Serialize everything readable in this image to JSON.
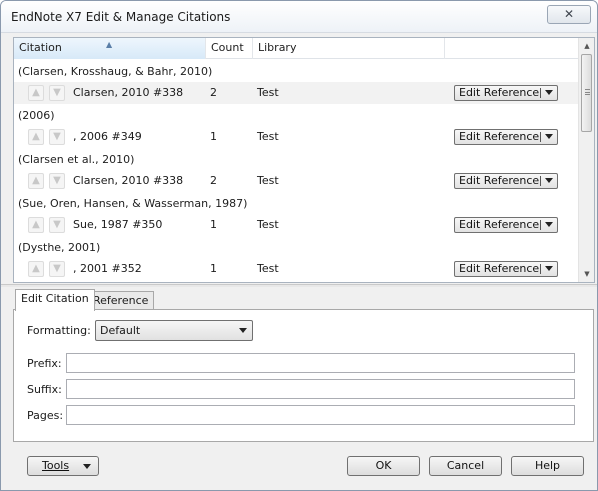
{
  "window": {
    "title": "EndNote X7 Edit & Manage Citations",
    "close_glyph": "✕"
  },
  "table": {
    "columns": [
      "Citation",
      "Count",
      "Library"
    ],
    "groups": [
      {
        "header": "(Clarsen, Krosshaug, & Bahr, 2010)",
        "citation": "Clarsen, 2010 #338",
        "count": "2",
        "library": "Test",
        "action": "Edit Reference",
        "highlighted": true
      },
      {
        "header": "(2006)",
        "citation": ", 2006 #349",
        "count": "1",
        "library": "Test",
        "action": "Edit Reference",
        "highlighted": false
      },
      {
        "header": "(Clarsen et al., 2010)",
        "citation": "Clarsen, 2010 #338",
        "count": "2",
        "library": "Test",
        "action": "Edit Reference",
        "highlighted": false
      },
      {
        "header": "(Sue, Oren, Hansen, & Wasserman, 1987)",
        "citation": "Sue, 1987 #350",
        "count": "1",
        "library": "Test",
        "action": "Edit Reference",
        "highlighted": false
      },
      {
        "header": "(Dysthe, 2001)",
        "citation": ", 2001 #352",
        "count": "1",
        "library": "Test",
        "action": "Edit Reference",
        "highlighted": false
      }
    ]
  },
  "tabs": {
    "edit_citation": "Edit Citation",
    "reference": "Reference"
  },
  "form": {
    "formatting_label": "Formatting:",
    "formatting_value": "Default",
    "prefix_label": "Prefix:",
    "suffix_label": "Suffix:",
    "pages_label": "Pages:",
    "prefix_value": "",
    "suffix_value": "",
    "pages_value": ""
  },
  "buttons": {
    "tools": "Tools",
    "ok": "OK",
    "cancel": "Cancel",
    "help": "Help"
  },
  "icons": {
    "move_up": "up-arrow-icon",
    "move_down": "down-arrow-icon",
    "sort": "sort-ascending-icon"
  }
}
